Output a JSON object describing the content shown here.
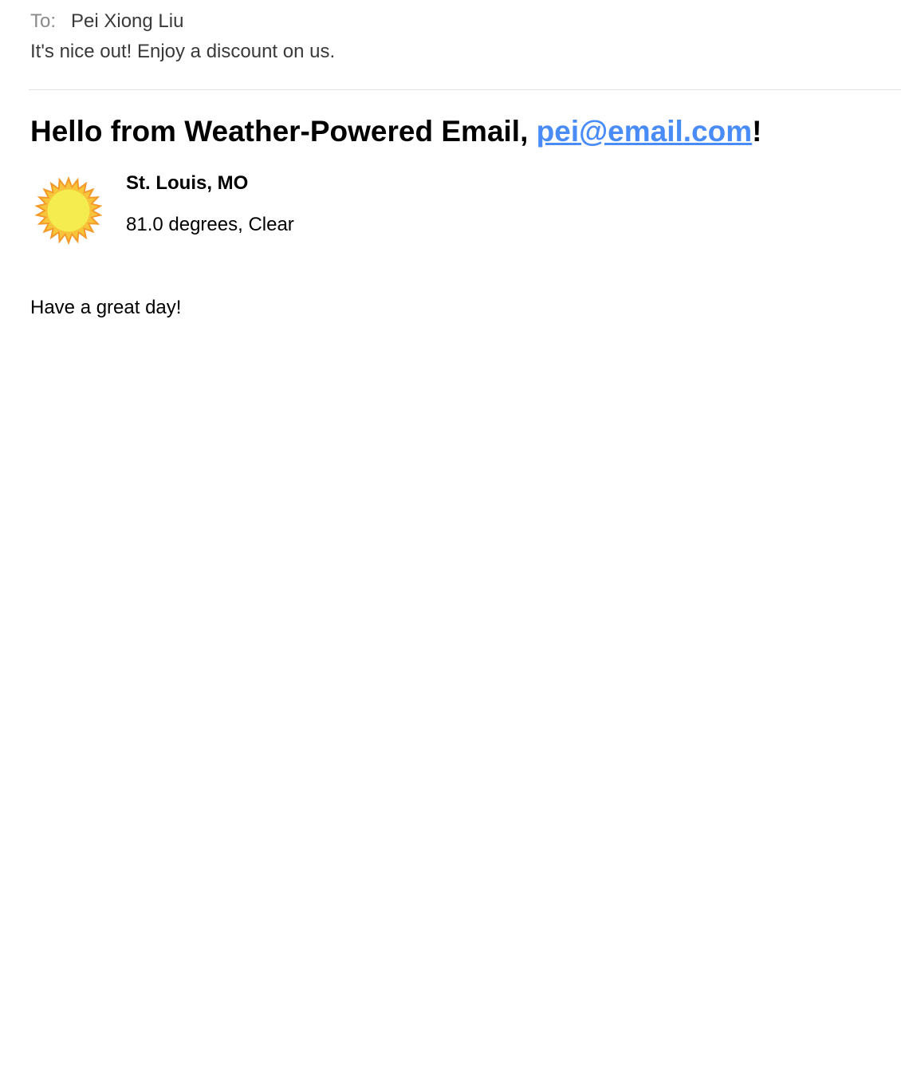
{
  "message_header": {
    "to_label": "To:",
    "to_name": "Pei Xiong Liu",
    "subject": "It's nice out! Enjoy a discount on us."
  },
  "email_body": {
    "greeting_prefix": "Hello from Weather-Powered Email, ",
    "recipient_email": "pei@email.com",
    "greeting_suffix": "!",
    "location": "St. Louis, MO",
    "conditions": "81.0 degrees, Clear",
    "weather_icon": "sun-icon",
    "signoff": "Have a great day!"
  },
  "colors": {
    "link": "#4a8cf7",
    "sun_fill": "#f5ec4f",
    "sun_rays": "#f39a2b"
  }
}
